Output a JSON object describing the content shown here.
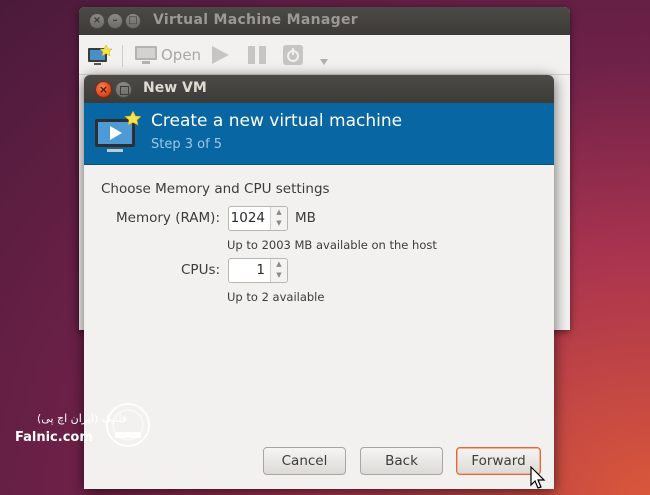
{
  "background_window": {
    "title": "Virtual Machine Manager",
    "toolbar": {
      "open_label": "Open"
    }
  },
  "dialog": {
    "title": "New VM",
    "header": {
      "title": "Create a new virtual machine",
      "step": "Step 3 of 5"
    },
    "section_label": "Choose Memory and CPU settings",
    "memory": {
      "label": "Memory (RAM):",
      "value": "1024",
      "unit": "MB",
      "hint": "Up to 2003 MB available on the host"
    },
    "cpus": {
      "label": "CPUs:",
      "value": "1",
      "hint": "Up to 2 available"
    },
    "buttons": {
      "cancel": "Cancel",
      "back": "Back",
      "forward": "Forward"
    }
  },
  "watermark": {
    "text_fa": "فلنیک (ایران اچ پی)",
    "text_en": "Falnic.com"
  },
  "colors": {
    "header_bg": "#0867a2",
    "close_button": "#e0491d",
    "default_button_border": "#e0693a"
  }
}
